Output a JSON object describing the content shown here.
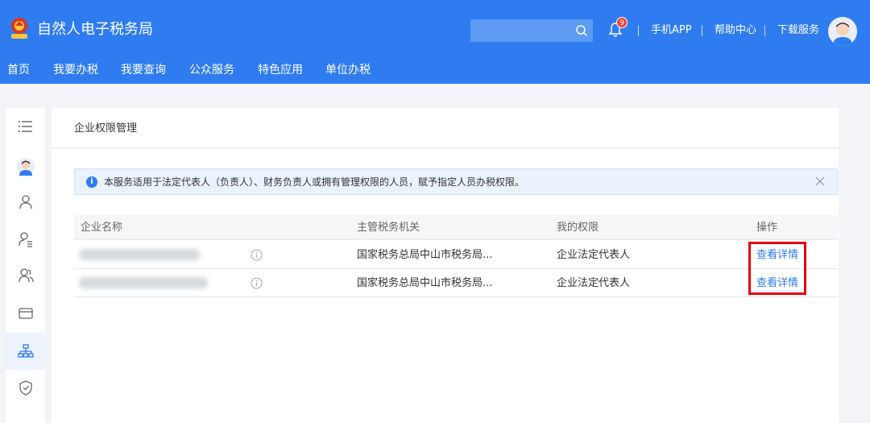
{
  "header": {
    "app_title": "自然人电子税务局",
    "notification_count": "9",
    "links": [
      "手机APP",
      "帮助中心",
      "下载服务"
    ],
    "brand_color": "#2f7cf0"
  },
  "nav": {
    "items": [
      "首页",
      "我要办税",
      "我要查询",
      "公众服务",
      "特色应用",
      "单位办税"
    ]
  },
  "sidebar": {
    "icons": [
      "menu-icon",
      "avatar-icon",
      "person-icon",
      "person-list-icon",
      "people-icon",
      "card-icon",
      "org-chart-icon",
      "shield-icon"
    ],
    "active": "org-chart-icon"
  },
  "page": {
    "title": "企业权限管理",
    "notice": "本服务适用于法定代表人（负责人）、财务负责人或拥有管理权限的人员，赋予指定人员办税权限。"
  },
  "table": {
    "headers": [
      "企业名称",
      "主管税务机关",
      "我的权限",
      "操作"
    ],
    "rows": [
      {
        "tax_office": "国家税务总局中山市税务局...",
        "permission": "企业法定代表人",
        "action": "查看详情"
      },
      {
        "tax_office": "国家税务总局中山市税务局...",
        "permission": "企业法定代表人",
        "action": "查看详情"
      }
    ]
  }
}
